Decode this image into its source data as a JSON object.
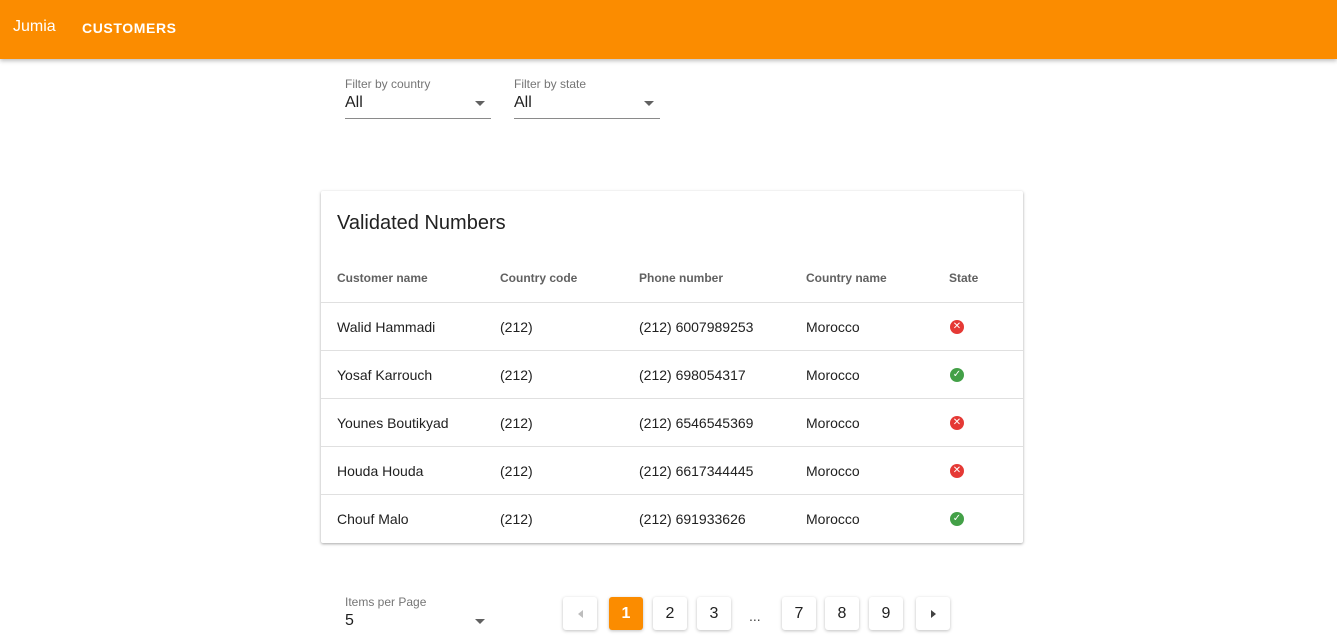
{
  "appbar": {
    "brand": "Jumia",
    "nav_customers": "CUSTOMERS",
    "color": "#fb8c00"
  },
  "filters": {
    "country": {
      "label": "Filter by country",
      "value": "All"
    },
    "state": {
      "label": "Filter by state",
      "value": "All"
    }
  },
  "table": {
    "title": "Validated Numbers",
    "columns": [
      "Customer name",
      "Country code",
      "Phone number",
      "Country name",
      "State"
    ],
    "rows": [
      {
        "name": "Walid Hammadi",
        "code": "(212)",
        "phone": "(212) 6007989253",
        "country": "Morocco",
        "state": "invalid",
        "state_icon": "close-circle-icon"
      },
      {
        "name": "Yosaf Karrouch",
        "code": "(212)",
        "phone": "(212) 698054317",
        "country": "Morocco",
        "state": "valid",
        "state_icon": "check-circle-icon"
      },
      {
        "name": "Younes Boutikyad",
        "code": "(212)",
        "phone": "(212) 6546545369",
        "country": "Morocco",
        "state": "invalid",
        "state_icon": "close-circle-icon"
      },
      {
        "name": "Houda Houda",
        "code": "(212)",
        "phone": "(212) 6617344445",
        "country": "Morocco",
        "state": "invalid",
        "state_icon": "close-circle-icon"
      },
      {
        "name": "Chouf Malo",
        "code": "(212)",
        "phone": "(212) 691933626",
        "country": "Morocco",
        "state": "valid",
        "state_icon": "check-circle-icon"
      }
    ]
  },
  "pagination": {
    "items_per_page_label": "Items per Page",
    "items_per_page_value": "5",
    "pages": [
      "1",
      "2",
      "3",
      "7",
      "8",
      "9"
    ],
    "ellipsis": "...",
    "current": "1"
  }
}
